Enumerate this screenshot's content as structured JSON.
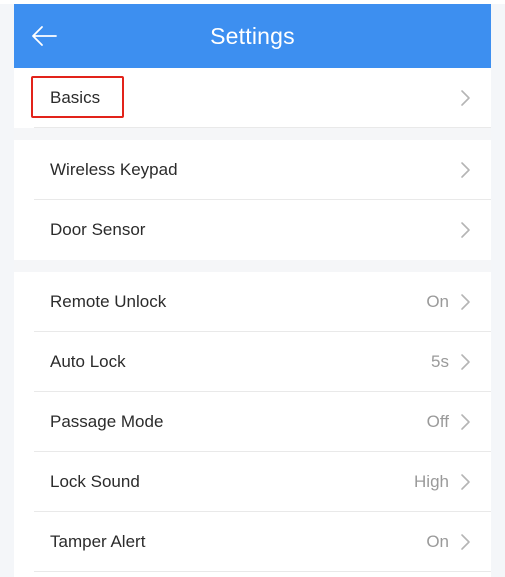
{
  "header": {
    "title": "Settings",
    "back_icon": "arrow-left-icon"
  },
  "groups": [
    {
      "items": [
        {
          "label": "Basics",
          "value": ""
        }
      ]
    },
    {
      "items": [
        {
          "label": "Wireless Keypad",
          "value": ""
        },
        {
          "label": "Door Sensor",
          "value": ""
        }
      ]
    },
    {
      "items": [
        {
          "label": "Remote Unlock",
          "value": "On"
        },
        {
          "label": "Auto Lock",
          "value": "5s"
        },
        {
          "label": "Passage Mode",
          "value": "Off"
        },
        {
          "label": "Lock Sound",
          "value": "High"
        },
        {
          "label": "Tamper Alert",
          "value": "On"
        }
      ]
    }
  ],
  "colors": {
    "header_bg": "#3d8ff0",
    "highlight_border": "#e2231a",
    "value_text": "#9a9a9a"
  }
}
